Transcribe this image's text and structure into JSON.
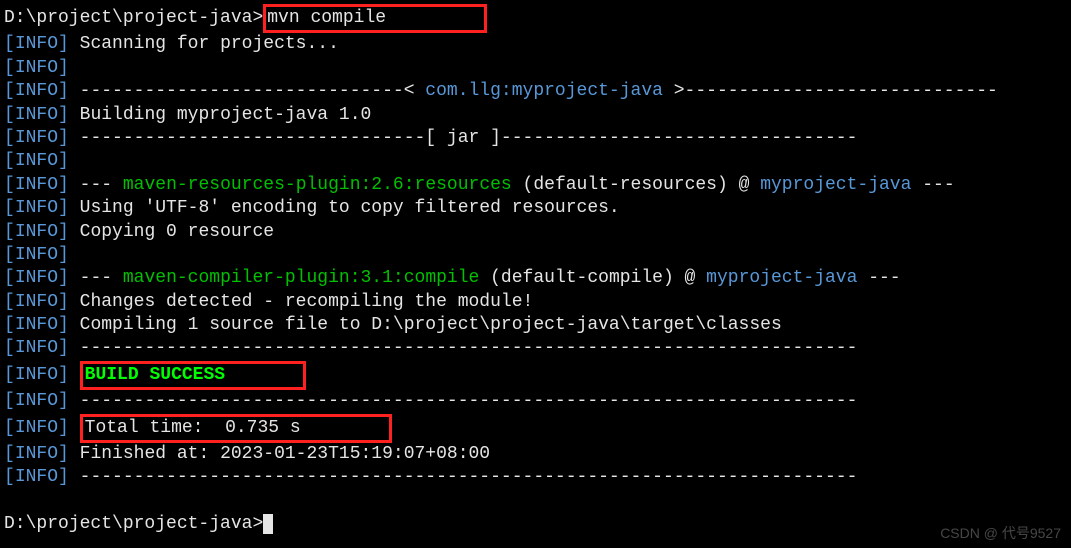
{
  "prompt1": {
    "path": "D:\\project\\project-java>",
    "cmd": "mvn compile"
  },
  "info_tag": {
    "open": "[",
    "label": "INFO",
    "close": "]"
  },
  "lines": {
    "scanning": " Scanning for projects...",
    "empty": "",
    "sep_long": " ------------------------------------------------------------------------",
    "proj_sep_pre": " ------------------------------<",
    "proj_id": " com.llg:myproject-java ",
    "proj_sep_post": ">-----------------------------",
    "building": " Building myproject-java 1.0",
    "jar_pre": " --------------------------------[",
    "jar_lbl": " jar ",
    "jar_post": "]---------------------------------",
    "res_pre": " ---",
    "res_plugin": " maven-resources-plugin:2.6:resources",
    "res_mid": " (default-resources) @ ",
    "res_proj": "myproject-java",
    "res_post": " ---",
    "utf8": " Using 'UTF-8' encoding to copy filtered resources.",
    "copy0": " Copying 0 resource",
    "cmp_pre": " ---",
    "cmp_plugin": " maven-compiler-plugin:3.1:compile",
    "cmp_mid": " (default-compile) @ ",
    "cmp_proj": "myproject-java",
    "cmp_post": " ---",
    "changes": " Changes detected - recompiling the module!",
    "compiling": " Compiling 1 source file to D:\\project\\project-java\\target\\classes",
    "build_success": "BUILD SUCCESS",
    "total_time": "Total time:  0.735 s",
    "finished": " Finished at: 2023-01-23T15:19:07+08:00"
  },
  "prompt2": {
    "path": "D:\\project\\project-java>"
  },
  "watermark": "CSDN @ 代号9527"
}
